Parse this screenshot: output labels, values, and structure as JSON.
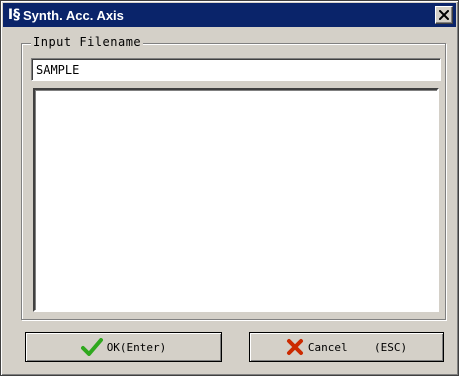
{
  "window": {
    "app_icon": "I§",
    "title": "Synth. Acc. Axis"
  },
  "group": {
    "label": "Input Filename"
  },
  "filename": {
    "value": "SAMPLE"
  },
  "buttons": {
    "ok_label": "OK(Enter)",
    "cancel_label": "Cancel    (ESC)"
  },
  "icons": {
    "ok": "checkmark-icon",
    "cancel": "x-icon",
    "close": "close-icon"
  },
  "colors": {
    "titlebar": "#0a246a",
    "dialog_face": "#d4d0c8",
    "ok_check": "#2fa81e",
    "cancel_x": "#cc2a00"
  }
}
